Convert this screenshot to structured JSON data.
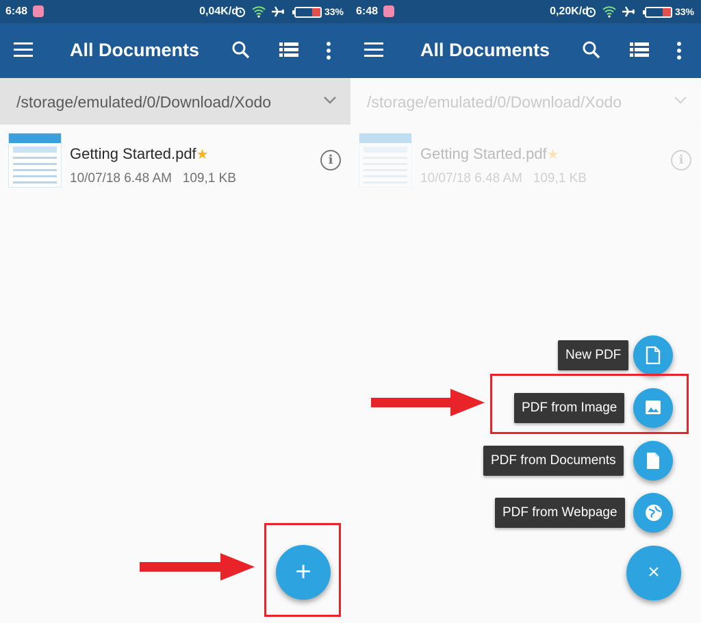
{
  "left": {
    "status": {
      "time": "6:48",
      "speed": "0,04K/d",
      "battery": "33%"
    },
    "toolbar": {
      "title": "All Documents"
    },
    "path": "/storage/emulated/0/Download/Xodo",
    "file": {
      "name": "Getting Started.pdf",
      "date": "10/07/18 6.48 AM",
      "size": "109,1 KB"
    },
    "fab_label": "+"
  },
  "right": {
    "status": {
      "time": "6:48",
      "speed": "0,20K/d",
      "battery": "33%"
    },
    "toolbar": {
      "title": "All Documents"
    },
    "path": "/storage/emulated/0/Download/Xodo",
    "file": {
      "name": "Getting Started.pdf",
      "date": "10/07/18 6.48 AM",
      "size": "109,1 KB"
    },
    "menu": {
      "new_pdf": "New PDF",
      "pdf_from_image": "PDF from Image",
      "pdf_from_documents": "PDF from Documents",
      "pdf_from_webpage": "PDF from Webpage"
    },
    "fab_close_label": "×"
  },
  "colors": {
    "status_bar": "#184f80",
    "toolbar": "#1e5b96",
    "fab": "#2da3df",
    "star": "#f7b51d",
    "annotation_red": "#e8232a"
  },
  "icons": [
    "menu-icon",
    "search-icon",
    "list-view-icon",
    "overflow-icon",
    "chevron-down-icon",
    "info-icon",
    "star-icon",
    "file-icon",
    "image-icon",
    "document-icon",
    "globe-icon",
    "plus-icon",
    "close-icon"
  ]
}
